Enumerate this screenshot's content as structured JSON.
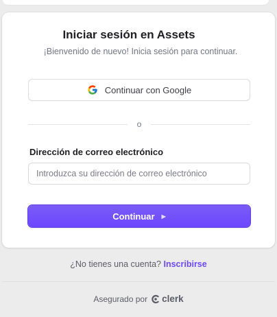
{
  "header": {
    "title": "Iniciar sesión en Assets",
    "subtitle": "¡Bienvenido de nuevo! Inicia sesión para continuar."
  },
  "social": {
    "google_label": "Continuar con Google",
    "icon": "google-icon"
  },
  "divider": {
    "text": "o"
  },
  "email": {
    "label": "Dirección de correo electrónico",
    "placeholder": "Introduzca su dirección de correo electrónico",
    "value": ""
  },
  "submit": {
    "label": "Continuar",
    "icon": "caret-right-icon"
  },
  "footer": {
    "prompt": "¿No tienes una cuenta?",
    "signup_link": "Inscribirse",
    "secured_by": "Asegurado por",
    "brand": "clerk"
  },
  "colors": {
    "primary": "#6c47ff",
    "text": "#202024",
    "muted": "#747686",
    "background": "#ececec"
  }
}
